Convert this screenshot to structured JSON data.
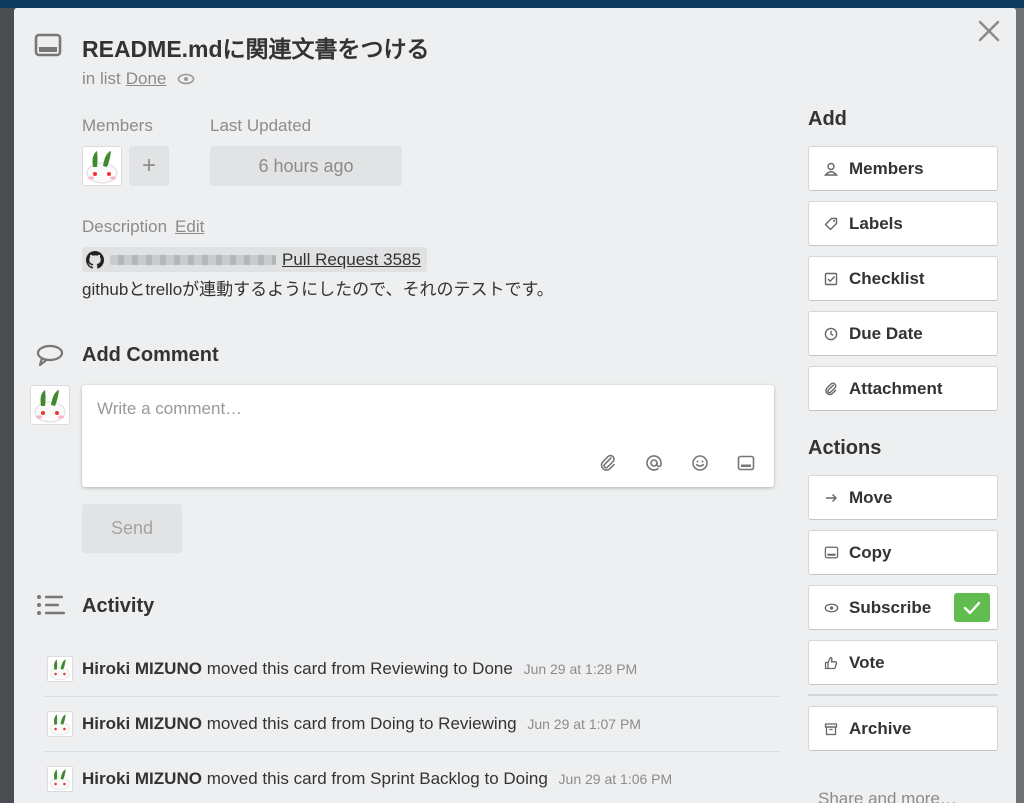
{
  "card": {
    "title": "README.mdに関連文書をつける",
    "in_list_prefix": "in list",
    "list_name": "Done"
  },
  "members": {
    "label": "Members",
    "add_symbol": "+"
  },
  "last_updated": {
    "label": "Last Updated",
    "value": "6 hours ago"
  },
  "description": {
    "label": "Description",
    "edit_label": "Edit",
    "pr_link": "Pull Request 3585",
    "text": "githubとtrelloが連動するようにしたので、それのテストです。"
  },
  "add_comment": {
    "title": "Add Comment",
    "placeholder": "Write a comment…",
    "send_label": "Send"
  },
  "activity": {
    "title": "Activity",
    "items": [
      {
        "user": "Hiroki MIZUNO",
        "action": "moved this card from Reviewing to Done",
        "time": "Jun 29 at 1:28 PM"
      },
      {
        "user": "Hiroki MIZUNO",
        "action": "moved this card from Doing to Reviewing",
        "time": "Jun 29 at 1:07 PM"
      },
      {
        "user": "Hiroki MIZUNO",
        "action": "moved this card from Sprint Backlog to Doing",
        "time": "Jun 29 at 1:06 PM"
      }
    ]
  },
  "sidebar": {
    "add_title": "Add",
    "add_buttons": [
      {
        "label": "Members",
        "icon": "person-icon"
      },
      {
        "label": "Labels",
        "icon": "tag-icon"
      },
      {
        "label": "Checklist",
        "icon": "checkbox-icon"
      },
      {
        "label": "Due Date",
        "icon": "clock-icon"
      },
      {
        "label": "Attachment",
        "icon": "paperclip-icon"
      }
    ],
    "actions_title": "Actions",
    "action_buttons": [
      {
        "label": "Move",
        "icon": "arrow-right-icon"
      },
      {
        "label": "Copy",
        "icon": "card-icon"
      },
      {
        "label": "Subscribe",
        "icon": "eye-icon",
        "checked": true
      },
      {
        "label": "Vote",
        "icon": "thumbs-up-icon"
      }
    ],
    "archive_label": "Archive",
    "share_label": "Share and more…"
  },
  "colors": {
    "accent_green": "#61bd4f",
    "modal_bg": "#edeff0",
    "header_bar": "#0e3a5d"
  }
}
